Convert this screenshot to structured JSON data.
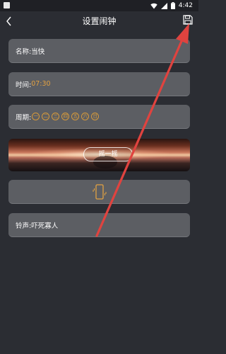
{
  "status_bar": {
    "time": "4:42"
  },
  "header": {
    "title": "设置闹钟"
  },
  "form": {
    "name": {
      "label": "名称:",
      "value": "当快"
    },
    "time": {
      "label": "时间:",
      "value": "07:30"
    },
    "period": {
      "label": "周期:",
      "days": [
        "一",
        "二",
        "三",
        "四",
        "五",
        "六",
        "日"
      ]
    },
    "shake": {
      "label": "摇一摇"
    },
    "ringtone": {
      "label": "铃声:",
      "value": "吓死寡人"
    }
  },
  "colors": {
    "background": "#2b2d33",
    "card": "#5c5e63",
    "accent_orange": "#e2a142",
    "annotation_red": "#e0433f"
  },
  "icons": [
    "back-arrow-icon",
    "save-icon",
    "phone-vibrate-icon",
    "wifi-icon",
    "signal-icon",
    "battery-icon"
  ]
}
